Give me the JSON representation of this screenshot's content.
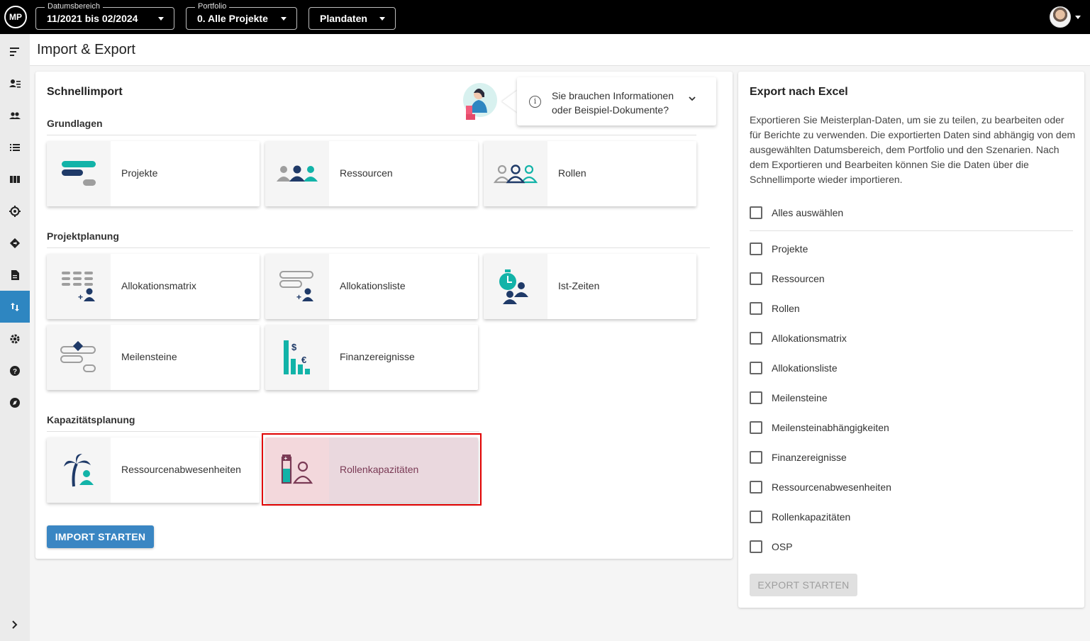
{
  "app": {
    "logo_text": "MP"
  },
  "topbar": {
    "date_range": {
      "label": "Datumsbereich",
      "value": "11/2021 bis 02/2024"
    },
    "portfolio": {
      "label": "Portfolio",
      "value": "0. Alle Projekte"
    },
    "scenario": {
      "value": "Plandaten"
    }
  },
  "page": {
    "title": "Import & Export"
  },
  "import": {
    "title": "Schnellimport",
    "info_text": "Sie brauchen Informationen oder Beispiel-Dokumente?",
    "sections": [
      {
        "title": "Grundlagen",
        "tiles": [
          "Projekte",
          "Ressourcen",
          "Rollen"
        ]
      },
      {
        "title": "Projektplanung",
        "tiles": [
          "Allokationsmatrix",
          "Allokationsliste",
          "Ist-Zeiten",
          "Meilensteine",
          "Finanzereignisse"
        ]
      },
      {
        "title": "Kapazitätsplanung",
        "tiles": [
          "Ressourcenabwesenheiten",
          "Rollenkapazitäten"
        ]
      }
    ],
    "selected_tile": "Rollenkapazitäten",
    "start_button": "IMPORT STARTEN"
  },
  "export": {
    "title": "Export nach Excel",
    "description": "Exportieren Sie Meisterplan-Daten, um sie zu teilen, zu bearbeiten oder für Berichte zu verwenden. Die exportierten Daten sind abhängig von dem ausgewählten Datumsbereich, dem Portfolio und den Szenarien. Nach dem Exportieren und Bearbeiten können Sie die Daten über die Schnellimporte wieder importieren.",
    "select_all": "Alles auswählen",
    "items": [
      "Projekte",
      "Ressourcen",
      "Rollen",
      "Allokationsmatrix",
      "Allokationsliste",
      "Meilensteine",
      "Meilensteinabhängigkeiten",
      "Finanzereignisse",
      "Ressourcenabwesenheiten",
      "Rollenkapazitäten",
      "OSP"
    ],
    "start_button": "EXPORT STARTEN"
  },
  "colors": {
    "teal": "#12b3a8",
    "navy": "#1f3a68",
    "gray": "#9e9e9e",
    "accent": "#3a86c3",
    "selected": "#ead8de",
    "highlight": "#e00000"
  }
}
